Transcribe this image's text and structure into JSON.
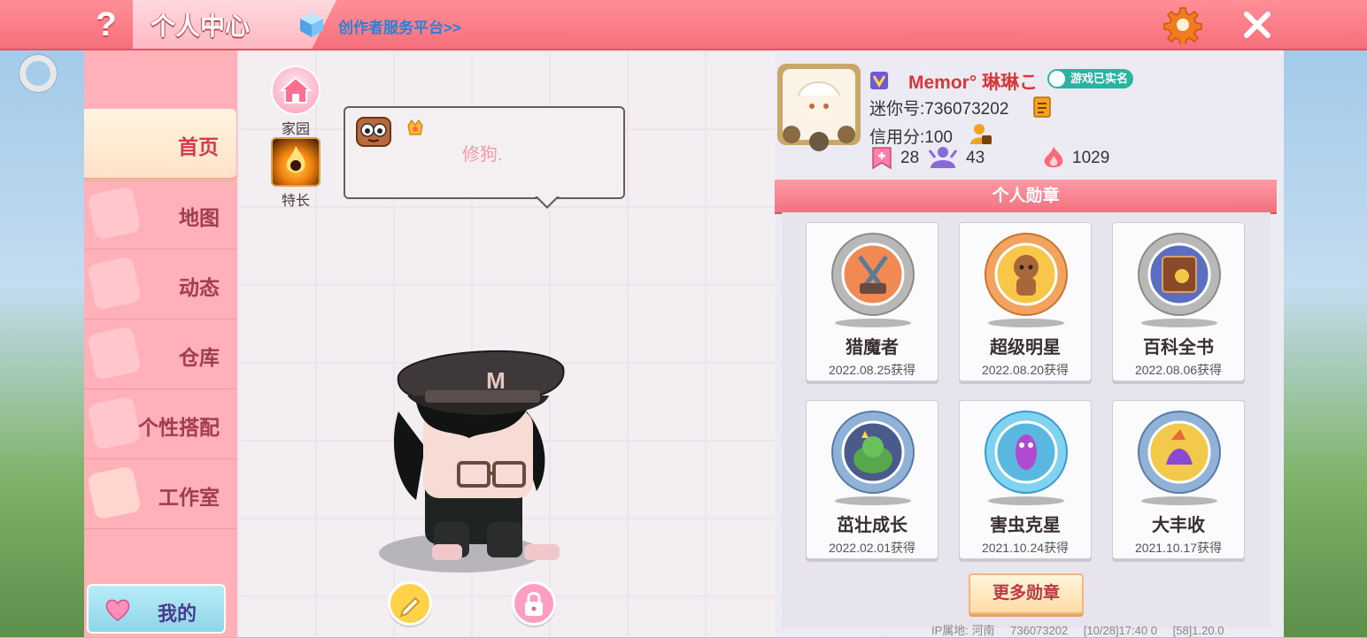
{
  "header": {
    "help_label": "?",
    "title": "个人中心",
    "creator_link": "创作者服务平台>>"
  },
  "sidebar": {
    "items": [
      {
        "label": "首页",
        "active": true
      },
      {
        "label": "地图"
      },
      {
        "label": "动态"
      },
      {
        "label": "仓库"
      },
      {
        "label": "个性搭配"
      },
      {
        "label": "工作室"
      }
    ],
    "my_button": "我的"
  },
  "center": {
    "home_label": "家园",
    "talent_label": "特长",
    "signature": "修狗.",
    "avatar_hat_letter": "M"
  },
  "profile": {
    "username": "Memor° 琳琳こ",
    "verified_label": "游戏已实名",
    "mini_id": "迷你号:736073202",
    "credit": "信用分:100",
    "stats": [
      "28",
      "43",
      "1029"
    ],
    "medals_title": "个人勋章",
    "medals": [
      {
        "name": "猎魔者",
        "date": "2022.08.25获得",
        "rim": "#b8b8b8",
        "inner": "#f08a52"
      },
      {
        "name": "超级明星",
        "date": "2022.08.20获得",
        "rim": "#f2a35e",
        "inner": "#f8c648"
      },
      {
        "name": "百科全书",
        "date": "2022.08.06获得",
        "rim": "#b8b8b8",
        "inner": "#5a6fbf"
      },
      {
        "name": "茁壮成长",
        "date": "2022.02.01获得",
        "rim": "#8fb2d6",
        "inner": "#56a84a"
      },
      {
        "name": "害虫克星",
        "date": "2021.10.24获得",
        "rim": "#7fd3ef",
        "inner": "#5ab8e0"
      },
      {
        "name": "大丰收",
        "date": "2021.10.17获得",
        "rim": "#8fb2d6",
        "inner": "#f2c94a"
      }
    ],
    "more_medals": "更多勋章"
  },
  "footer": {
    "ip_location": "IP属地: 河南",
    "uid": "736073202",
    "time": "[10/28]17:40 0",
    "version": "[58]1.20.0"
  },
  "colors": {
    "topbar": "#f56f7c",
    "sidebar": "#ffb0b8",
    "accent_red": "#d8383a",
    "verified": "#2bb3a1"
  }
}
